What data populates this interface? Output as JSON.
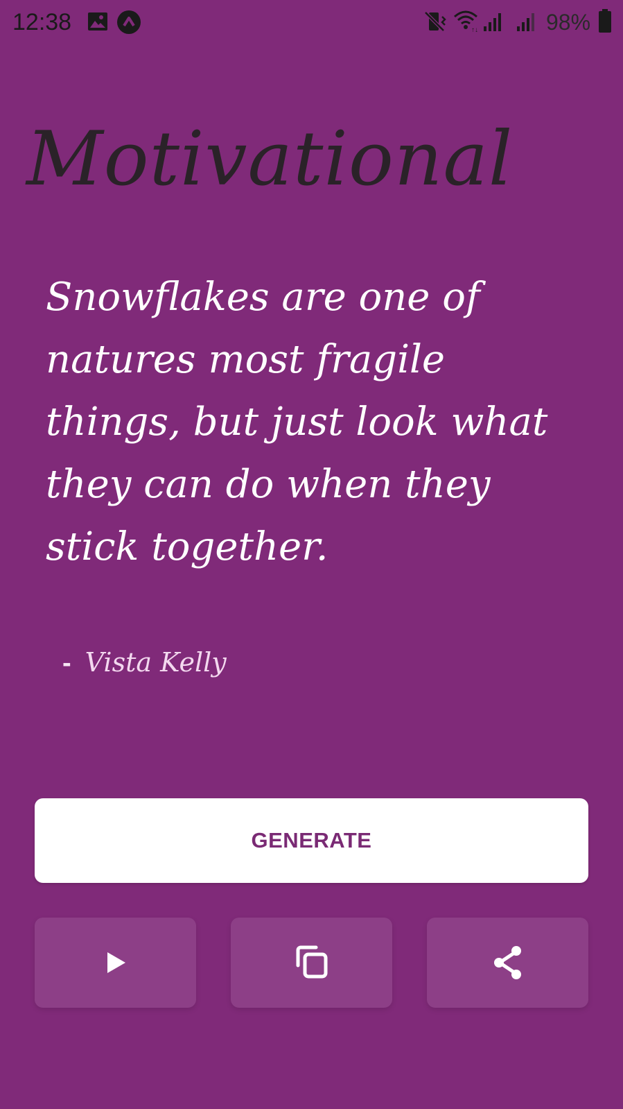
{
  "status_bar": {
    "time": "12:38",
    "battery_percent": "98%",
    "icons": [
      "gallery-icon",
      "app-notification-icon",
      "vibrate-icon",
      "wifi-icon",
      "signal-icon",
      "signal-icon-2",
      "battery-icon"
    ]
  },
  "app": {
    "title": "Motivational"
  },
  "quote": {
    "text": "Snowflakes are one of natures most fragile things, but just look what they can do when they stick together.",
    "dash": "-",
    "author": "Vista Kelly"
  },
  "buttons": {
    "generate_label": "GENERATE",
    "play_icon": "play-icon",
    "copy_icon": "copy-icon",
    "share_icon": "share-icon"
  },
  "colors": {
    "background": "#802a79",
    "button_background": "#ffffff",
    "button_text": "#7a2a74",
    "action_button": "#8d3f87",
    "title_text": "#2a2228",
    "quote_text": "#ffffff",
    "author_text": "#f3d8ef"
  }
}
